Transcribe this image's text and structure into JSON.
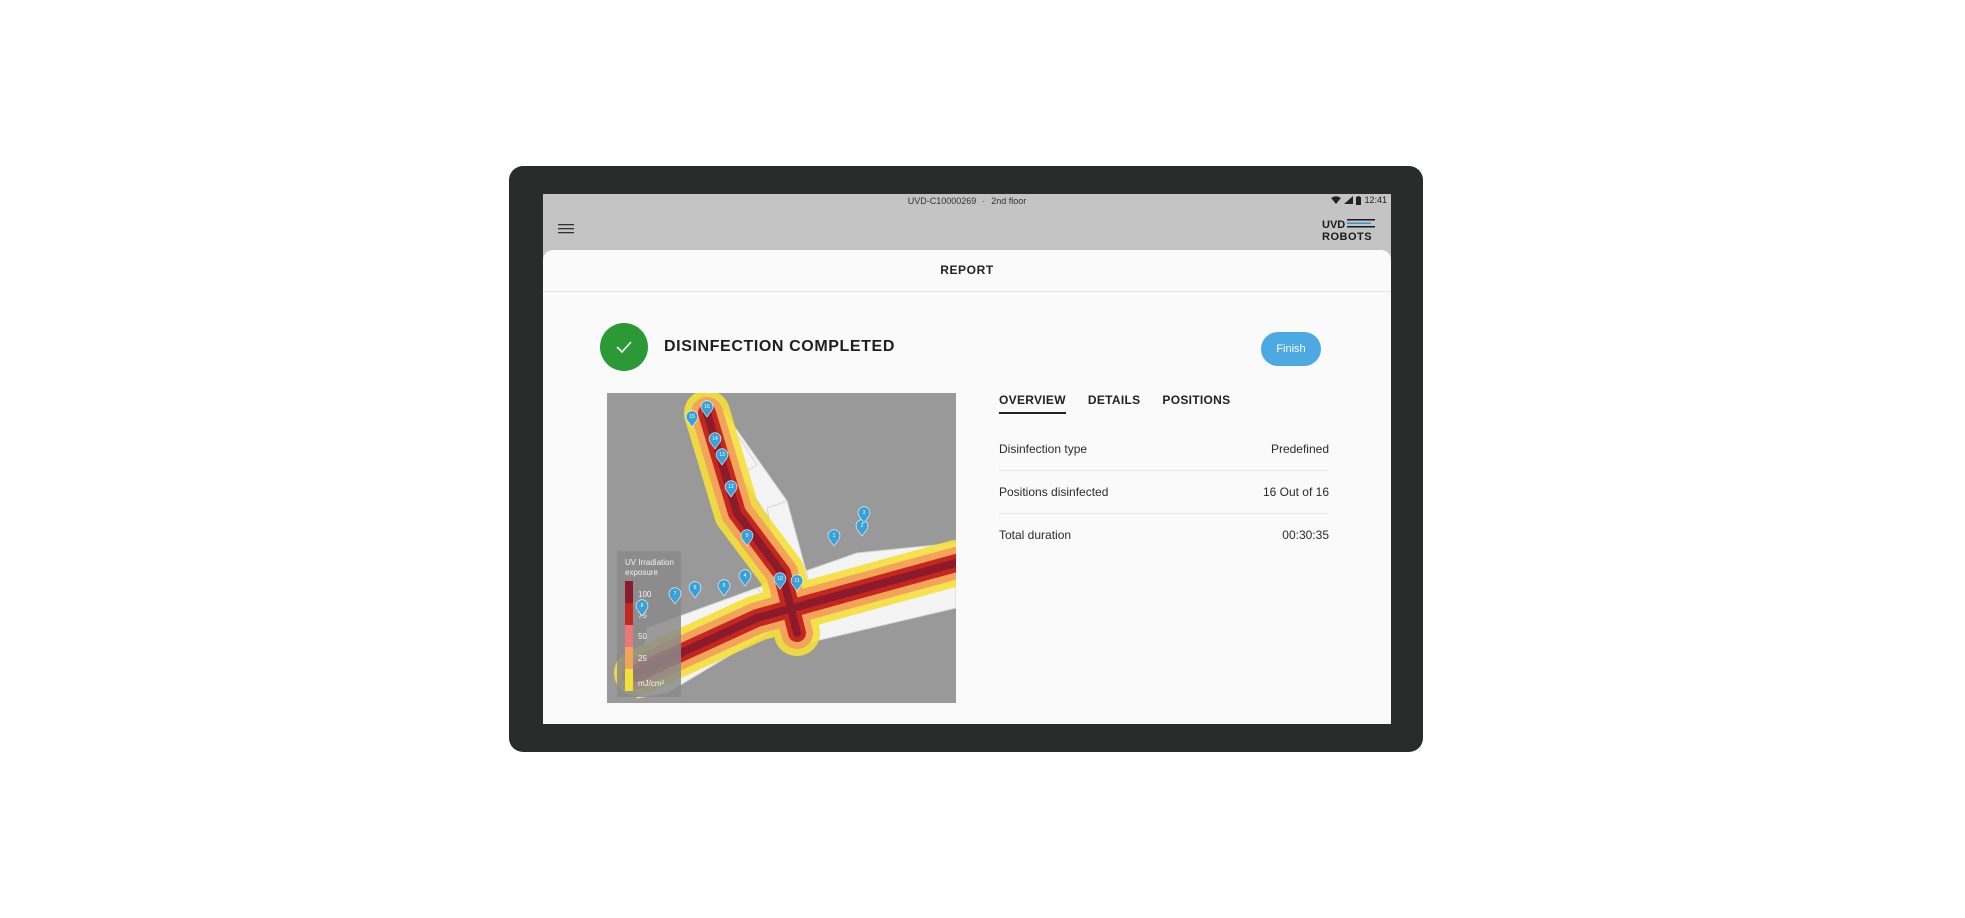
{
  "status_bar": {
    "device_id": "UVD-C10000269",
    "separator": "·",
    "location": "2nd floor",
    "time": "12:41"
  },
  "app_bar": {
    "menu_icon": "hamburger-menu-icon",
    "logo_line1": "UVD",
    "logo_line2": "ROBOTS"
  },
  "report": {
    "title": "REPORT",
    "status_icon": "check-icon",
    "status_title": "DISINFECTION COMPLETED",
    "status_color": "#2b9a36",
    "finish_label": "Finish",
    "accent_color": "#4da9e2"
  },
  "tabs": [
    {
      "label": "OVERVIEW",
      "active": true
    },
    {
      "label": "DETAILS",
      "active": false
    },
    {
      "label": "POSITIONS",
      "active": false
    }
  ],
  "overview": [
    {
      "label": "Disinfection type",
      "value": "Predefined"
    },
    {
      "label": "Positions disinfected",
      "value": "16 Out of 16"
    },
    {
      "label": "Total duration",
      "value": "00:30:35"
    }
  ],
  "map": {
    "legend_title_line1": "UV Irradiation",
    "legend_title_line2": "exposure",
    "legend_ticks": [
      "100",
      "75",
      "50",
      "25"
    ],
    "legend_unit": "mJ/cm²",
    "legend_colors": [
      "#8b1a2b",
      "#c4271f",
      "#e9787a",
      "#f2a45a",
      "#f5e03a"
    ],
    "position_markers": [
      "1",
      "2",
      "3",
      "4",
      "5",
      "6",
      "7",
      "8",
      "9",
      "10",
      "11",
      "12",
      "13",
      "14",
      "15",
      "16"
    ]
  }
}
